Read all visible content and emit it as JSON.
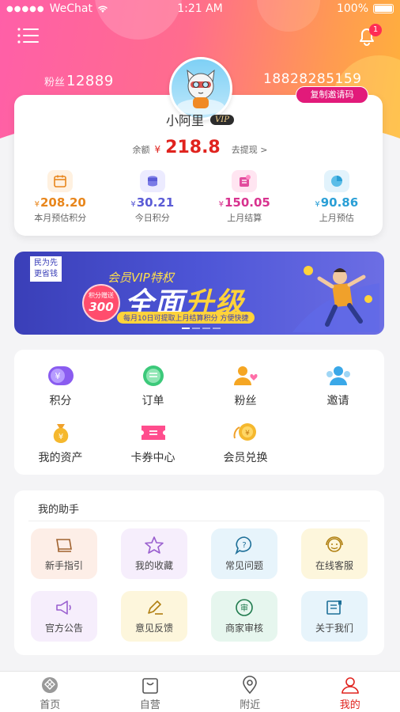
{
  "status_bar": {
    "signal": "●●●●●",
    "carrier": "WeChat",
    "time": "1:21 AM",
    "battery": "100%"
  },
  "header": {
    "fans_label": "粉丝",
    "fans_count": "12889",
    "phone": "18828285159",
    "copy_invite_label": "复制邀请码",
    "notification_count": "1"
  },
  "profile": {
    "name": "小阿里",
    "vip_badge": "VIP",
    "balance_label": "余额",
    "currency": "¥",
    "balance": "218.8",
    "withdraw_link": "去提现 >"
  },
  "stats": [
    {
      "currency": "¥",
      "value": "208.20",
      "label": "本月预估积分",
      "color": "#e8861c",
      "icon": "calendar-icon",
      "bg": "#fff1e0"
    },
    {
      "currency": "¥",
      "value": "30.21",
      "label": "今日积分",
      "color": "#5a5bd6",
      "icon": "coins-icon",
      "bg": "#ecebff"
    },
    {
      "currency": "¥",
      "value": "150.05",
      "label": "上月结算",
      "color": "#d8338f",
      "icon": "settlement-icon",
      "bg": "#ffe5f1"
    },
    {
      "currency": "¥",
      "value": "90.86",
      "label": "上月预估",
      "color": "#2a9fd6",
      "icon": "pie-chart-icon",
      "bg": "#e2f3fc"
    }
  ],
  "banner": {
    "tag": "民为先\n更省钱",
    "subtitle": "会员VIP特权",
    "title_a": "全面",
    "title_b": "升级",
    "circle_top": "积分赠送",
    "circle_num": "300",
    "note": "每月10日可提取上月结算积分  方便快捷"
  },
  "grid": [
    {
      "label": "积分",
      "icon": "points-icon"
    },
    {
      "label": "订单",
      "icon": "order-icon"
    },
    {
      "label": "粉丝",
      "icon": "fans-icon"
    },
    {
      "label": "邀请",
      "icon": "invite-icon"
    },
    {
      "label": "我的资产",
      "icon": "money-bag-icon"
    },
    {
      "label": "卡券中心",
      "icon": "coupon-icon"
    },
    {
      "label": "会员兑换",
      "icon": "exchange-icon"
    }
  ],
  "helper": {
    "title": "我的助手",
    "items": [
      {
        "label": "新手指引",
        "icon": "guide-book-icon",
        "bg": "#fdeee7"
      },
      {
        "label": "我的收藏",
        "icon": "star-icon",
        "bg": "#f6eefc"
      },
      {
        "label": "常见问题",
        "icon": "question-icon",
        "bg": "#e7f4fb"
      },
      {
        "label": "在线客服",
        "icon": "customer-service-icon",
        "bg": "#fdf6dc"
      },
      {
        "label": "官方公告",
        "icon": "megaphone-icon",
        "bg": "#f6eefc"
      },
      {
        "label": "意见反馈",
        "icon": "feedback-pen-icon",
        "bg": "#fdf6dc"
      },
      {
        "label": "商家审核",
        "icon": "review-icon",
        "bg": "#e6f6ee"
      },
      {
        "label": "关于我们",
        "icon": "about-icon",
        "bg": "#e7f4fb"
      }
    ]
  },
  "tabbar": [
    {
      "label": "首页",
      "icon": "home-icon",
      "active": false
    },
    {
      "label": "自营",
      "icon": "shop-bag-icon",
      "active": false
    },
    {
      "label": "附近",
      "icon": "location-icon",
      "active": false
    },
    {
      "label": "我的",
      "icon": "profile-icon",
      "active": true
    }
  ]
}
